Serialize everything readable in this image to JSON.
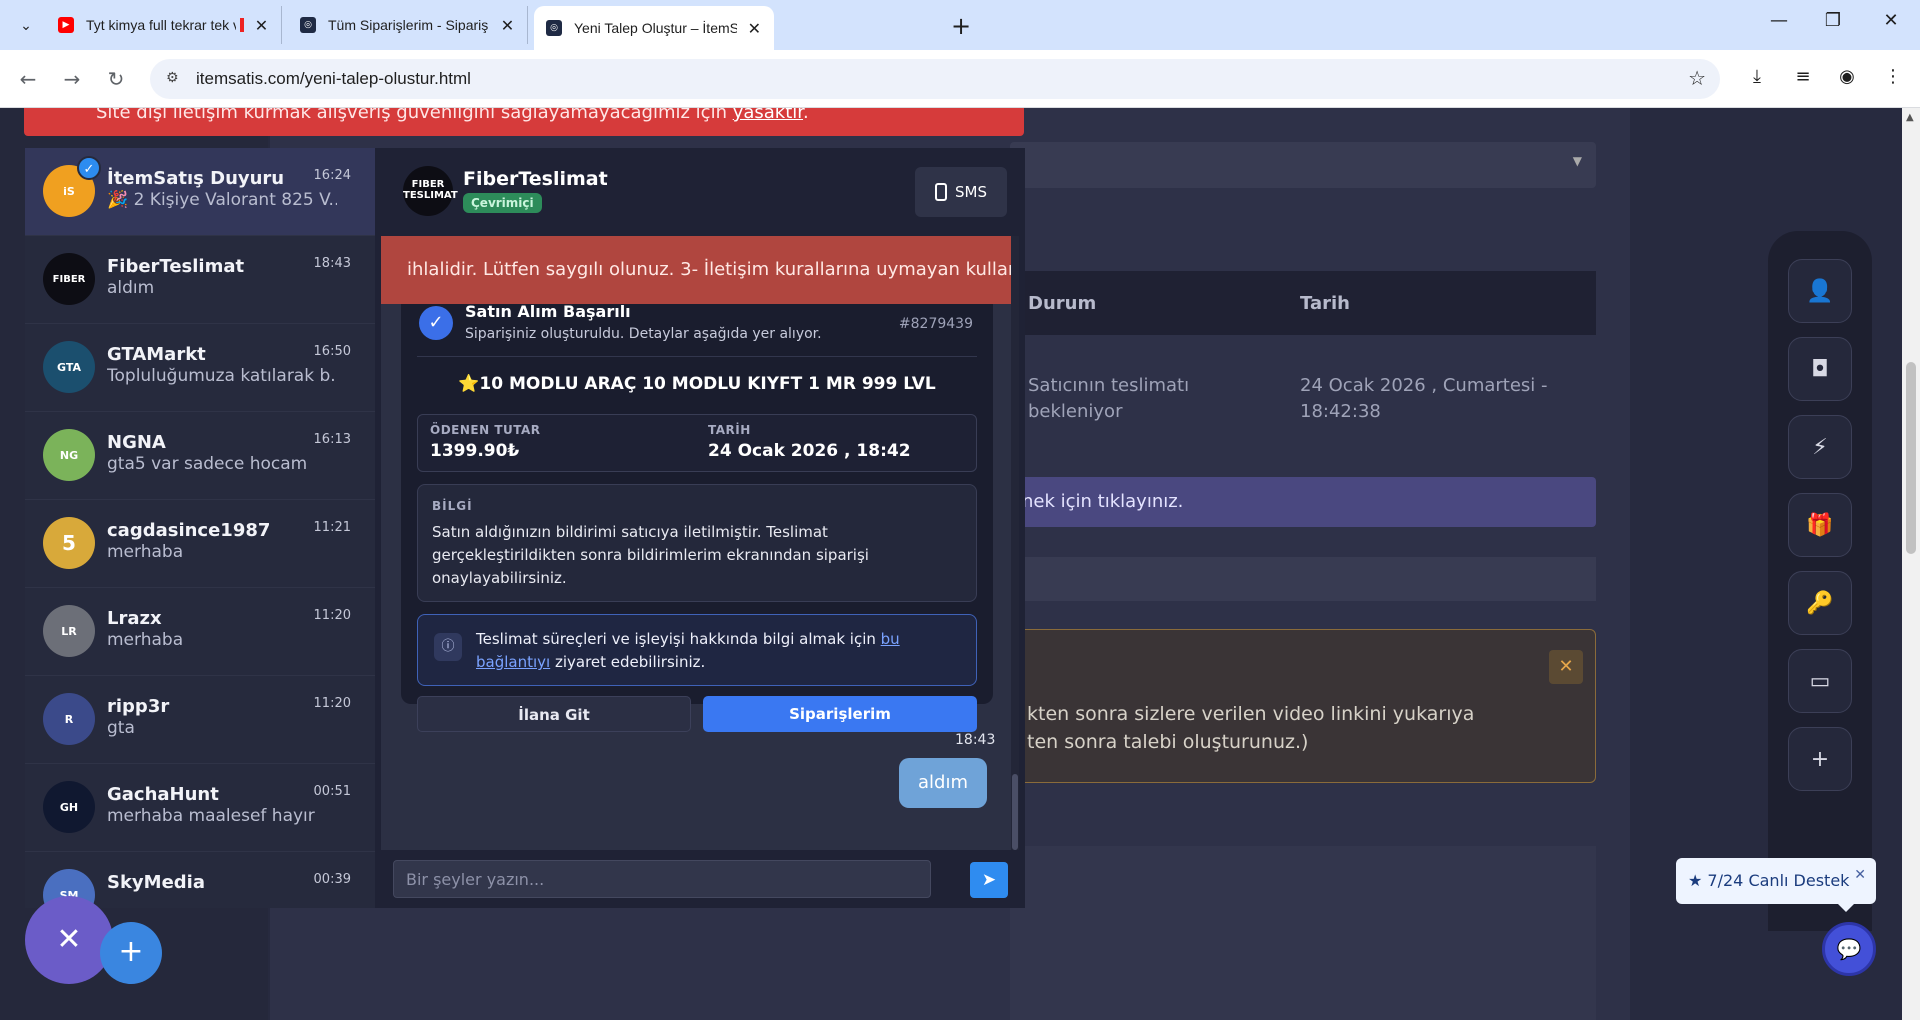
{
  "browser": {
    "tabs": [
      {
        "title": "Tyt kimya full tekrar tek video",
        "favicon_color": "#ff0000",
        "close": "✕"
      },
      {
        "title": "Tüm Siparişlerim - Sipariş Geçmi",
        "favicon_color": "#1f2a44",
        "close": "✕"
      },
      {
        "title": "Yeni Talep Oluştur – İtemSatış D",
        "favicon_color": "#1f2a44",
        "close": "✕"
      }
    ],
    "new_tab": "+",
    "url": "itemsatis.com/yeni-talep-olustur.html"
  },
  "page": {
    "alert_text": "Site dışı iletişim kurmak alışveriş güvenliğini sağlayamayacağımız için ",
    "alert_link": "yasaktır",
    "alert_tail": ".",
    "table_headers": {
      "status": "Durum",
      "date": "Tarih"
    },
    "row": {
      "status": "Satıcının teslimatı bekleniyor",
      "date": "24 Ocak 2026 , Cumartesi - 18:42:38"
    },
    "banner_text": "nek için tıklayınız.",
    "warning_text_1": "kten sonra sizlere verilen video linkini yukarıya",
    "warning_text_2": "ten sonra talebi oluşturunuz.)",
    "warning_close": "✕"
  },
  "conversations": [
    {
      "name": "İtemSatış Duyuru",
      "preview": "🎉 2 Kişiye Valorant 825 V...",
      "time": "16:24",
      "avatar_color": "#f0a020",
      "avatar_text": "iS",
      "verified": true,
      "active": true
    },
    {
      "name": "FiberTeslimat",
      "preview": "aldım",
      "time": "18:43",
      "avatar_color": "#0d0d14",
      "avatar_text": "FIBER",
      "verified": false,
      "active": false
    },
    {
      "name": "GTAMarkt",
      "preview": "Topluluğumuza katılarak b...",
      "time": "16:50",
      "avatar_color": "#1b4f6e",
      "avatar_text": "GTA",
      "verified": false,
      "active": false
    },
    {
      "name": "NGNA",
      "preview": "gta5 var sadece hocam",
      "time": "16:13",
      "avatar_color": "#7bb35a",
      "avatar_text": "NG",
      "verified": false,
      "active": false
    },
    {
      "name": "cagdasince1987",
      "preview": "merhaba",
      "time": "11:21",
      "avatar_color": "#d8a93a",
      "avatar_text": "5",
      "verified": false,
      "active": false
    },
    {
      "name": "Lrazx",
      "preview": "merhaba",
      "time": "11:20",
      "avatar_color": "#6c6f78",
      "avatar_text": "LR",
      "verified": false,
      "active": false
    },
    {
      "name": "ripp3r",
      "preview": "gta",
      "time": "11:20",
      "avatar_color": "#3b4a8a",
      "avatar_text": "R",
      "verified": false,
      "active": false
    },
    {
      "name": "GachaHunt",
      "preview": "merhaba maalesef hayır",
      "time": "00:51",
      "avatar_color": "#101830",
      "avatar_text": "GH",
      "verified": false,
      "active": false
    },
    {
      "name": "SkyMedia",
      "preview": "",
      "time": "00:39",
      "avatar_color": "#4a6fc0",
      "avatar_text": "SM",
      "verified": false,
      "active": false
    }
  ],
  "chat": {
    "contact_name": "FiberTeslimat",
    "contact_status": "Çevrimiçi",
    "avatar_text": "FIBER TESLIMAT",
    "sms_label": "SMS",
    "rule_banner": "ihlalidir. Lütfen saygılı olunuz. 3- İletişim kurallarına uymayan kullanı",
    "order": {
      "title": "Satın Alım Başarılı",
      "subtitle": "Siparişiniz oluşturuldu. Detaylar aşağıda yer alıyor.",
      "id": "#8279439",
      "product": "⭐10 MODLU ARAÇ 10 MODLU KIYFT 1 MR 999 LVL",
      "paid_label": "ÖDENEN TUTAR",
      "paid_value": "1399.90₺",
      "date_label": "TARİH",
      "date_value": "24 Ocak 2026 , 18:42",
      "info_title": "BİLGİ",
      "info_body": "Satın aldığınızın bildirimi satıcıya iletilmiştir. Teslimat gerçekleştirildikten sonra bildirimlerim ekranından siparişi onaylayabilirsiniz.",
      "link_text_pre": "Teslimat süreçleri ve işleyişi hakkında bilgi almak için ",
      "link_text_link": "bu bağlantıyı",
      "link_text_post": " ziyaret edebilirsiniz.",
      "btn_listing": "İlana Git",
      "btn_orders": "Siparişlerim"
    },
    "message": {
      "time": "18:43",
      "text": "aldım"
    },
    "input_placeholder": "Bir şeyler yazın..."
  },
  "support": {
    "label": "★ 7/24 Canlı Destek",
    "close": "✕"
  },
  "colors": {
    "accent": "#3a78f2",
    "alert_red": "#d63b3b",
    "online_green": "#2d8c5a",
    "bubble": "#6fa3d8"
  }
}
